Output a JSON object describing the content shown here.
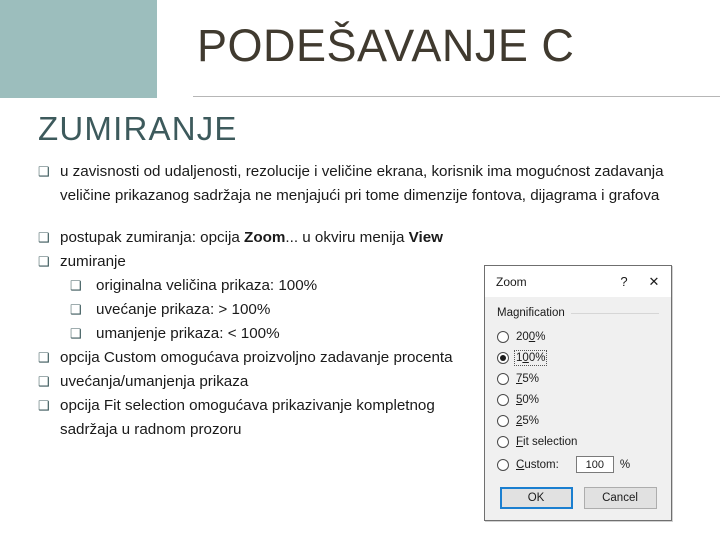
{
  "slide": {
    "title": "PODEŠAVANJE C",
    "section_heading": "ZUMIRANJE",
    "accent_color": "#9cbebd",
    "heading_color": "#3d5a5c",
    "title_color": "#403a2f",
    "bullet_glyph": "❑"
  },
  "bullets": [
    {
      "level": 1,
      "width": "wide",
      "text": "u zavisnosti od udaljenosti, rezolucije i veličine ekrana, korisnik ima mogućnost zadavanja veličine prikazanog sadržaja ne menjajući pri tome dimenzije fontova, dijagrama i grafova"
    },
    {
      "level": 1,
      "width": "narrow",
      "rich": true,
      "parts": [
        {
          "text": " postupak zumiranja: opcija ",
          "bold": false
        },
        {
          "text": "Zoom",
          "bold": true
        },
        {
          "text": "... u okviru menija ",
          "bold": false
        },
        {
          "text": "View",
          "bold": true
        }
      ]
    },
    {
      "level": 1,
      "width": "narrow",
      "text": "zumiranje"
    },
    {
      "level": 2,
      "text": "originalna veličina prikaza: 100%"
    },
    {
      "level": 2,
      "text": "uvećanje prikaza: > 100%"
    },
    {
      "level": 2,
      "text": "umanjenje prikaza: < 100%"
    },
    {
      "level": 1,
      "width": "narrow",
      "text": " opcija Custom omogućava proizvoljno zadavanje procenta"
    },
    {
      "level": 1,
      "width": "narrow",
      "text": "uvećanja/umanjenja prikaza"
    },
    {
      "level": 1,
      "width": "narrow",
      "text": " opcija Fit selection omogućava prikazivanje kompletnog sadržaja  u radnom prozoru"
    }
  ],
  "dialog": {
    "title": "Zoom",
    "help_glyph": "?",
    "close_glyph": "✕",
    "group_label": "Magnification",
    "options": [
      {
        "label": "200%",
        "accesskey_index": 2,
        "selected": false
      },
      {
        "label": "100%",
        "accesskey_index": 1,
        "selected": true
      },
      {
        "label": "75%",
        "accesskey_index": 0,
        "selected": false
      },
      {
        "label": "50%",
        "accesskey_index": 0,
        "selected": false
      },
      {
        "label": "25%",
        "accesskey_index": 0,
        "selected": false
      },
      {
        "label": "Fit selection",
        "accesskey_index": 0,
        "selected": false
      },
      {
        "label": "Custom:",
        "accesskey_index": 0,
        "selected": false
      }
    ],
    "custom_value": "100",
    "percent_sign": "%",
    "ok_label": "OK",
    "cancel_label": "Cancel",
    "focus_color": "#1b7fd0"
  }
}
